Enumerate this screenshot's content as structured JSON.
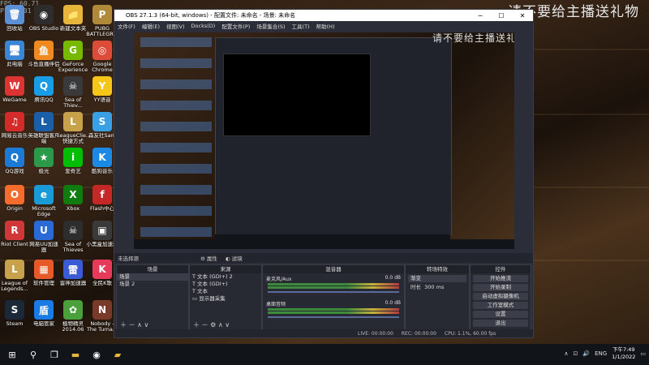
{
  "watermark_text": "请不要给主播送礼物",
  "stream_overlay": {
    "fps": "FPS: 60.71",
    "line2": "P1 0.101"
  },
  "desktop_icons": [
    {
      "label": "回收站",
      "icon": "recycle-bin",
      "color": "#5b8fd6",
      "glyph": "🗑"
    },
    {
      "label": "OBS Studio",
      "icon": "obs",
      "color": "#2d2d2d",
      "glyph": "◉"
    },
    {
      "label": "新建文本夹",
      "icon": "folder",
      "color": "#e7b53a",
      "glyph": "📁"
    },
    {
      "label": "PUBG BATTLEGR...",
      "icon": "pubg",
      "color": "#b08a3a",
      "glyph": "P"
    },
    {
      "label": "此电脑",
      "icon": "computer",
      "color": "#3a86d6",
      "glyph": "🖥"
    },
    {
      "label": "斗鱼直播伴侣",
      "icon": "douyu",
      "color": "#f08a1e",
      "glyph": "鱼"
    },
    {
      "label": "GeForce Experience",
      "icon": "geforce",
      "color": "#76b900",
      "glyph": "G"
    },
    {
      "label": "Google Chrome",
      "icon": "chrome",
      "color": "#dd4b39",
      "glyph": "◎"
    },
    {
      "label": "WeGame",
      "icon": "wegame",
      "color": "#d33",
      "glyph": "W"
    },
    {
      "label": "腾讯QQ",
      "icon": "qq",
      "color": "#1a9be6",
      "glyph": "Q"
    },
    {
      "label": "Sea of Thiev...",
      "icon": "sea-of-thieves",
      "color": "#3a3a3a",
      "glyph": "☠"
    },
    {
      "label": "YY语音",
      "icon": "yy",
      "color": "#f5c518",
      "glyph": "Y"
    },
    {
      "label": "网易云音乐",
      "icon": "netease-music",
      "color": "#d52a2a",
      "glyph": "♫"
    },
    {
      "label": "英雄联盟客户端",
      "icon": "lol-client",
      "color": "#1a5fa8",
      "glyph": "L"
    },
    {
      "label": "LeagueClie... 快捷方式",
      "icon": "league-client",
      "color": "#c8a24a",
      "glyph": "L"
    },
    {
      "label": "森友社Sam",
      "icon": "sam",
      "color": "#3aa0e6",
      "glyph": "S"
    },
    {
      "label": "QQ游戏",
      "icon": "qq-game",
      "color": "#1a7ad6",
      "glyph": "Q"
    },
    {
      "label": "极光",
      "icon": "jiguang",
      "color": "#2a9a4a",
      "glyph": "★"
    },
    {
      "label": "爱奇艺",
      "icon": "iqiyi",
      "color": "#00be06",
      "glyph": "i"
    },
    {
      "label": "酷狗音乐",
      "icon": "kugou",
      "color": "#1a8ae6",
      "glyph": "K"
    },
    {
      "label": "Origin",
      "icon": "origin",
      "color": "#f56c2d",
      "glyph": "O"
    },
    {
      "label": "Microsoft Edge",
      "icon": "edge",
      "color": "#1a9ad6",
      "glyph": "e"
    },
    {
      "label": "Xbox",
      "icon": "xbox",
      "color": "#107c10",
      "glyph": "X"
    },
    {
      "label": "Flash中心",
      "icon": "flash",
      "color": "#c62828",
      "glyph": "f"
    },
    {
      "label": "Riot Client",
      "icon": "riot",
      "color": "#d13639",
      "glyph": "R"
    },
    {
      "label": "网易UU加速器",
      "icon": "uu",
      "color": "#2a6ad6",
      "glyph": "U"
    },
    {
      "label": "Sea of Thieves",
      "icon": "sea-of-thieves-2",
      "color": "#2d2d2d",
      "glyph": "☠"
    },
    {
      "label": "小黑盒加速器",
      "icon": "xiaoheihe",
      "color": "#3a3a3a",
      "glyph": "▣"
    },
    {
      "label": "League of Legends...",
      "icon": "lol",
      "color": "#c8a24a",
      "glyph": "L"
    },
    {
      "label": "软件管理",
      "icon": "software-manager",
      "color": "#e65a2a",
      "glyph": "▦"
    },
    {
      "label": "雷神加速器",
      "icon": "leishen",
      "color": "#3a5ad6",
      "glyph": "雷"
    },
    {
      "label": "全民K歌",
      "icon": "kge",
      "color": "#e63a5a",
      "glyph": "K"
    },
    {
      "label": "Steam",
      "icon": "steam",
      "color": "#1b2838",
      "glyph": "S"
    },
    {
      "label": "电脑管家",
      "icon": "pc-manager",
      "color": "#1a7ae6",
      "glyph": "盾"
    },
    {
      "label": "植物精灵 2014.06",
      "icon": "plant",
      "color": "#4aa03a",
      "glyph": "✿"
    },
    {
      "label": "Nobody - The Turna...",
      "icon": "nobody",
      "color": "#7a3a2a",
      "glyph": "N"
    }
  ],
  "obs": {
    "title": "OBS 27.1.3 (64-bit, windows) - 配置文件: 未命名 - 场景: 未命名",
    "menu": [
      "文件(F)",
      "编辑(E)",
      "视图(V)",
      "Docks(D)",
      "配置文件(P)",
      "场景集合(S)",
      "工具(T)",
      "帮助(H)"
    ],
    "source_bar": {
      "label": "未选择源",
      "properties": "属性",
      "filters": "滤镜"
    },
    "scenes": {
      "header": "场景",
      "items": [
        "场景",
        "场景 2"
      ]
    },
    "sources": {
      "header": "来源",
      "items": [
        "文本 (GDI+) 2",
        "文本 (GDI+)",
        "文本",
        "显示器采集"
      ]
    },
    "mixer": {
      "header": "混音器",
      "channels": [
        {
          "name": "麦克风/Aux",
          "db": "0.0 dB"
        },
        {
          "name": "桌面音频",
          "db": "0.0 dB"
        }
      ]
    },
    "transitions": {
      "header": "转场特效",
      "type": "渐变",
      "duration_label": "时长",
      "duration_value": "300 ms"
    },
    "controls": {
      "header": "控件",
      "buttons": [
        "开始推流",
        "开始录制",
        "启动虚拟摄像机",
        "工作室模式",
        "设置",
        "退出"
      ]
    },
    "status": {
      "live": "LIVE: 00:00:00",
      "rec": "REC: 00:00:00",
      "cpu": "CPU: 1.1%, 60.00 fps"
    }
  },
  "taskbar": {
    "lang": "ENG",
    "time": "下午7:49",
    "date": "1/1/2022"
  }
}
